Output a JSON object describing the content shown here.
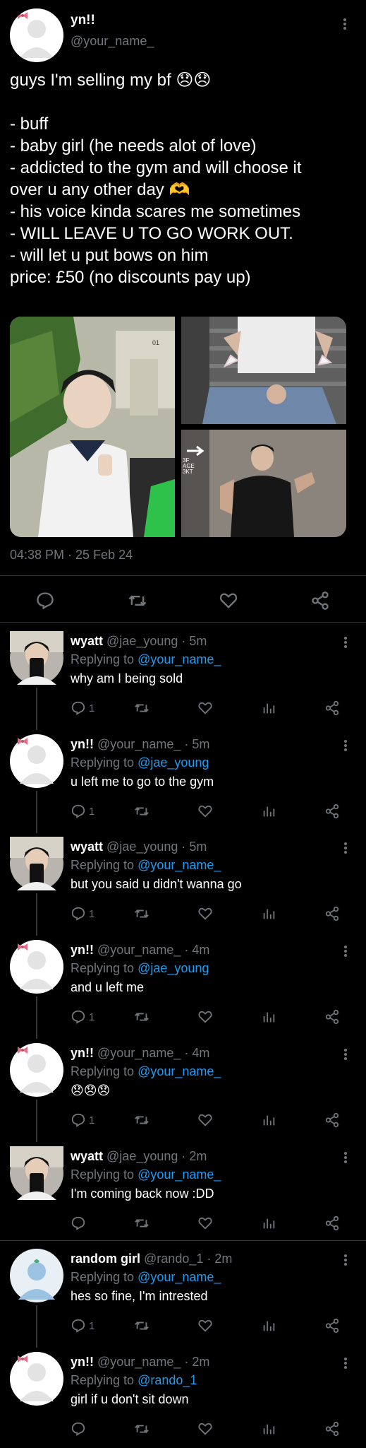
{
  "tweet": {
    "author_name": "yn!!",
    "author_handle": "@your_name_",
    "lines": [
      "guys I'm selling my bf 😞😞",
      "",
      "- buff",
      "- baby girl (he needs alot of love)",
      "- addicted to the gym and will choose it",
      "over u any other day 🫶",
      "- his voice kinda scares me sometimes",
      "- WILL LEAVE U TO GO WORK OUT.",
      "- will let u put bows on him",
      "price: £50 (no discounts pay up)"
    ],
    "timestamp": "04:38 PM · 25 Feb 24"
  },
  "photos": {
    "p1": {
      "sign_top": "01",
      "bg": "#9aa08f"
    },
    "p2": {
      "bg": "#6b6b6b"
    },
    "p3": {
      "sign_text": "3F\nAGE\n3KT",
      "bg": "#7c7570"
    }
  },
  "colors": {
    "accent": "#1d9bf0",
    "muted": "#71767b",
    "divider": "#2f3336"
  },
  "replies": [
    {
      "name": "wyatt",
      "handle": "@jae_young",
      "time": "5m",
      "replying_label": "Replying to",
      "replying_to": "@your_name_",
      "text": "why am I being sold",
      "reply_count": "1",
      "avatar": "wyatt"
    },
    {
      "name": "yn!!",
      "handle": "@your_name_",
      "time": "5m",
      "replying_label": "Replying to",
      "replying_to": "@jae_young",
      "text": "u left me to go to the gym",
      "reply_count": "1",
      "avatar": "yn"
    },
    {
      "name": "wyatt",
      "handle": "@jae_young",
      "time": "5m",
      "replying_label": "Replying to",
      "replying_to": "@your_name_",
      "text": "but you said u didn't wanna go",
      "reply_count": "1",
      "avatar": "wyatt"
    },
    {
      "name": "yn!!",
      "handle": "@your_name_",
      "time": "4m",
      "replying_label": "Replying to",
      "replying_to": "@jae_young",
      "text": "and u left me",
      "reply_count": "1",
      "avatar": "yn"
    },
    {
      "name": "yn!!",
      "handle": "@your_name_",
      "time": "4m",
      "replying_label": "Replying to",
      "replying_to": "@your_name_",
      "text": "😞😞😞",
      "reply_count": "1",
      "avatar": "yn"
    },
    {
      "name": "wyatt",
      "handle": "@jae_young",
      "time": "2m",
      "replying_label": "Replying to",
      "replying_to": "@your_name_",
      "text": "I'm coming back now :DD",
      "reply_count": "",
      "avatar": "wyatt"
    },
    {
      "name": "random girl",
      "handle": "@rando_1",
      "time": "2m",
      "replying_label": "Replying to",
      "replying_to": "@your_name_",
      "text": "hes so fine, I'm intrested",
      "reply_count": "1",
      "avatar": "random"
    },
    {
      "name": "yn!!",
      "handle": "@your_name_",
      "time": "2m",
      "replying_label": "Replying to",
      "replying_to": "@rando_1",
      "text": "girl if u don't sit down",
      "reply_count": "",
      "avatar": "yn"
    }
  ]
}
